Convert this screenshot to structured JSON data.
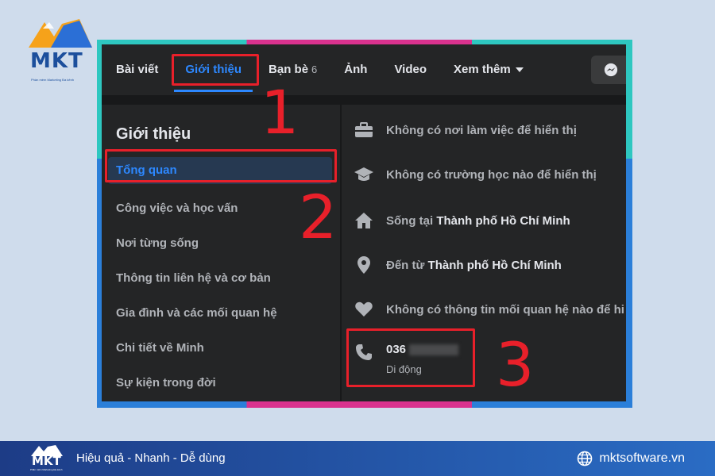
{
  "brand": {
    "logo_text": "MKT",
    "logo_subtext": "Phần mềm Marketing Đa kênh",
    "colors": {
      "primary": "#1c4f9c",
      "accent": "#f6a21a",
      "annotation_red": "#e8202a"
    }
  },
  "facebook": {
    "tabs": [
      {
        "label": "Bài viết"
      },
      {
        "label": "Giới thiệu",
        "active": true
      },
      {
        "label": "Bạn bè",
        "count": "6"
      },
      {
        "label": "Ảnh"
      },
      {
        "label": "Video"
      },
      {
        "label": "Xem thêm"
      }
    ],
    "messenger_icon": "messenger-icon",
    "about": {
      "title": "Giới thiệu",
      "nav": [
        {
          "label": "Tổng quan",
          "selected": true
        },
        {
          "label": "Công việc và học vấn"
        },
        {
          "label": "Nơi từng sống"
        },
        {
          "label": "Thông tin liên hệ và cơ bản"
        },
        {
          "label": "Gia đình và các mối quan hệ"
        },
        {
          "label": "Chi tiết về Minh"
        },
        {
          "label": "Sự kiện trong đời"
        }
      ],
      "overview": [
        {
          "icon": "briefcase-icon",
          "text": "Không có nơi làm việc để hiển thị"
        },
        {
          "icon": "graduation-cap-icon",
          "text": "Không có trường học nào để hiển thị"
        },
        {
          "icon": "home-icon",
          "prefix": "Sống tại ",
          "strong": "Thành phố Hồ Chí Minh"
        },
        {
          "icon": "location-pin-icon",
          "prefix": "Đến từ ",
          "strong": "Thành phố Hồ Chí Minh"
        },
        {
          "icon": "heart-icon",
          "text": "Không có thông tin mối quan hệ nào để hi"
        }
      ],
      "phone": {
        "icon": "phone-icon",
        "number_visible": "036",
        "label": "Di động"
      }
    }
  },
  "annotations": {
    "step1": "1",
    "step2": "2",
    "step3": "3"
  },
  "footer": {
    "logo_text": "MKT",
    "logo_subtext": "Phần mềm Marketing Đa kênh",
    "slogan": "Hiệu quả - Nhanh - Dễ dùng",
    "website": "mktsoftware.vn"
  }
}
